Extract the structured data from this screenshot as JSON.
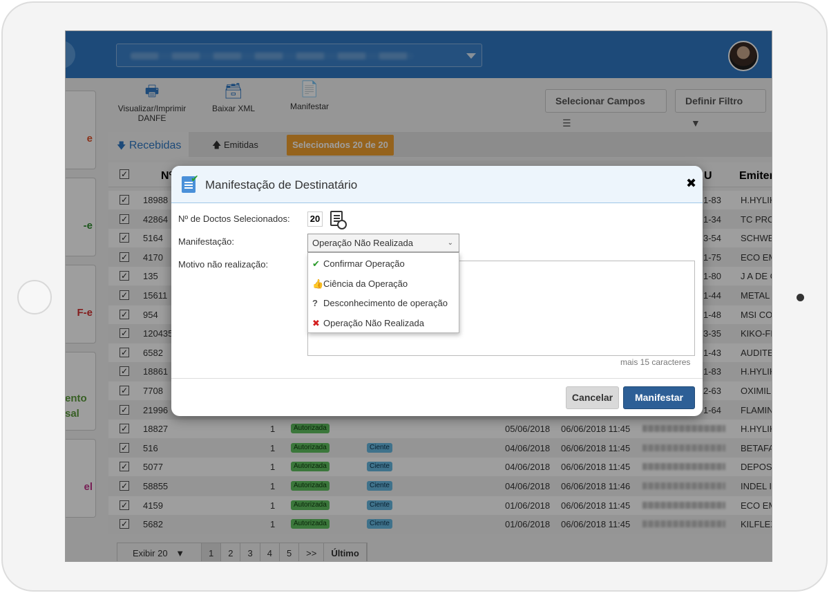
{
  "toolbar": {
    "print_label": "Visualizar/Imprimir DANFE",
    "download_label": "Baixar XML",
    "manifest_label": "Manifestar",
    "select_fields_label": "Selecionar Campos",
    "filter_label": "Definir Filtro"
  },
  "left_rail": [
    {
      "label": "e",
      "color": "#e0522a"
    },
    {
      "label": "-e",
      "color": "#2e8b2e"
    },
    {
      "label": "F-e",
      "color": "#d42f2f"
    },
    {
      "label": "ento sal",
      "color": "#5a9a3a"
    },
    {
      "label": "el",
      "color": "#c0328a"
    }
  ],
  "tabs": {
    "received": "Recebidas",
    "issued": "Emitidas",
    "selected_badge": "Selecionados 20 de 20"
  },
  "table": {
    "headers": {
      "number": "Nº",
      "issuer": "Emitente",
      "cnpj_suffix": "U"
    },
    "rows": [
      {
        "num": "18988",
        "cnpj": "1-83",
        "issuer": "H.HYLIK"
      },
      {
        "num": "42864",
        "cnpj": "1-34",
        "issuer": "TC PRO"
      },
      {
        "num": "5164",
        "cnpj": "3-54",
        "issuer": "SCHWE"
      },
      {
        "num": "4170",
        "cnpj": "1-75",
        "issuer": "ECO EM"
      },
      {
        "num": "135",
        "cnpj": "1-80",
        "issuer": "J A DE C"
      },
      {
        "num": "15611",
        "cnpj": "1-44",
        "issuer": "METAL I"
      },
      {
        "num": "954",
        "cnpj": "1-48",
        "issuer": "MSI CO"
      },
      {
        "num": "120435",
        "cnpj": "3-35",
        "issuer": "KIKO-FL"
      },
      {
        "num": "6582",
        "cnpj": "1-43",
        "issuer": "AUDITE"
      },
      {
        "num": "18861",
        "cnpj": "1-83",
        "issuer": "H.HYLIK"
      },
      {
        "num": "7708",
        "cnpj": "2-63",
        "issuer": "OXIMIL"
      },
      {
        "num": "21996",
        "cnpj": "1-64",
        "issuer": "FLAMIN"
      },
      {
        "num": "18827",
        "qty": "1",
        "status": "Autorizada",
        "manif": "",
        "emission": "05/06/2018",
        "received": "06/06/2018 11:45",
        "issuer": "H.HYLIK"
      },
      {
        "num": "516",
        "qty": "1",
        "status": "Autorizada",
        "manif": "Ciente",
        "emission": "04/06/2018",
        "received": "06/06/2018 11:45",
        "issuer": "BETAFA"
      },
      {
        "num": "5077",
        "qty": "1",
        "status": "Autorizada",
        "manif": "Ciente",
        "emission": "04/06/2018",
        "received": "06/06/2018 11:45",
        "issuer": "DEPOSI"
      },
      {
        "num": "58855",
        "qty": "1",
        "status": "Autorizada",
        "manif": "Ciente",
        "emission": "04/06/2018",
        "received": "06/06/2018 11:46",
        "issuer": "INDEL I"
      },
      {
        "num": "4159",
        "qty": "1",
        "status": "Autorizada",
        "manif": "Ciente",
        "emission": "01/06/2018",
        "received": "06/06/2018 11:45",
        "issuer": "ECO EM"
      },
      {
        "num": "5682",
        "qty": "1",
        "status": "Autorizada",
        "manif": "Ciente",
        "emission": "01/06/2018",
        "received": "06/06/2018 11:45",
        "issuer": "KILFLEX"
      }
    ]
  },
  "pager": {
    "show_label": "Exibir 20",
    "pages": [
      "1",
      "2",
      "3",
      "4",
      "5",
      ">>"
    ],
    "last_label": "Último"
  },
  "modal": {
    "title": "Manifestação de Destinatário",
    "count_label": "Nº de Doctos Selecionados:",
    "count_value": "20",
    "manifest_label": "Manifestação:",
    "manifest_value": "Operação Não Realizada",
    "reason_label": "Motivo não realização:",
    "chars_hint": "mais 15 caracteres",
    "options": [
      {
        "label": "Confirmar Operação",
        "icon": "✔",
        "color": "#2a9a2a"
      },
      {
        "label": "Ciência da Operação",
        "icon": "👍",
        "color": "#3a86d0"
      },
      {
        "label": "Desconhecimento de operação",
        "icon": "?",
        "color": "#555555"
      },
      {
        "label": "Operação Não Realizada",
        "icon": "✖",
        "color": "#d42020"
      }
    ],
    "cancel_label": "Cancelar",
    "submit_label": "Manifestar"
  }
}
